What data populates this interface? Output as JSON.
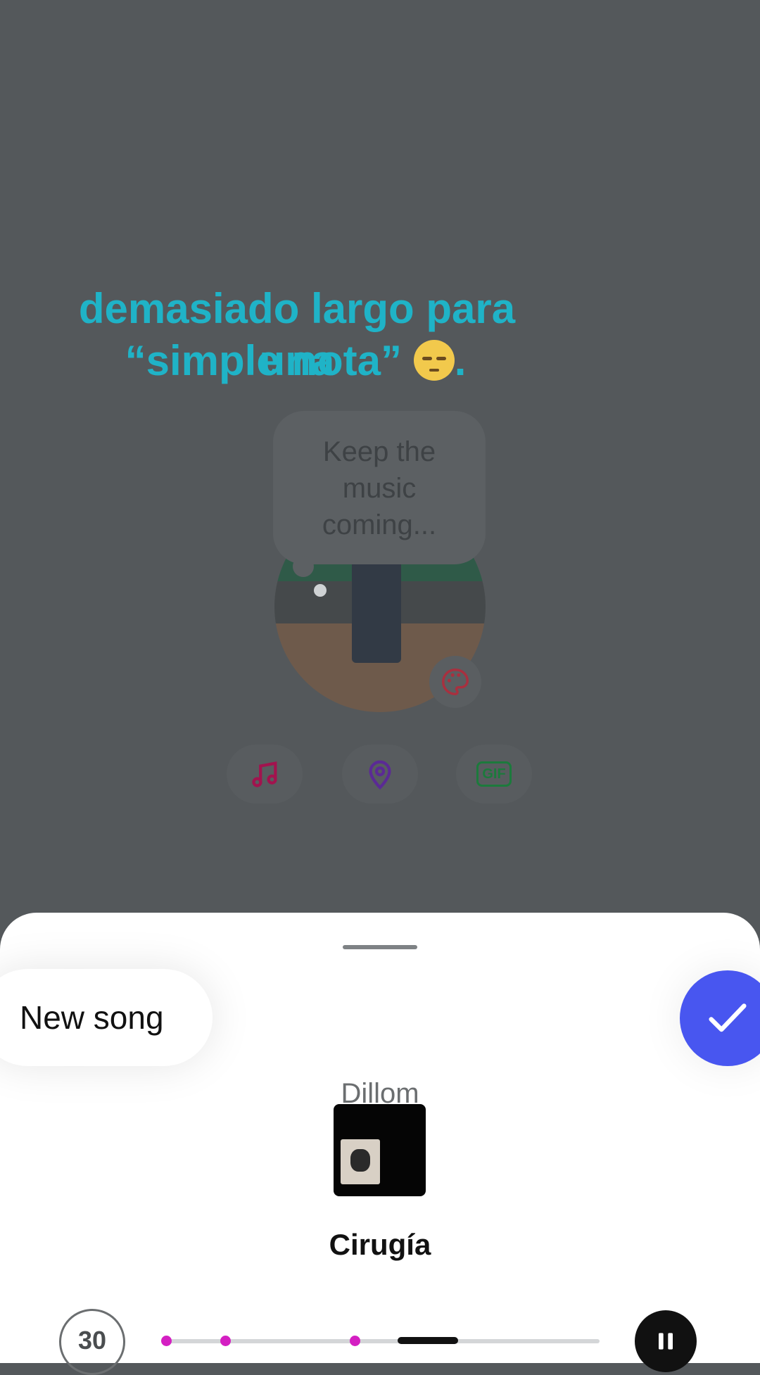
{
  "caption": {
    "line1": "demasiado largo para una",
    "line2": "“simple nota”",
    "line2_suffix": ".",
    "color": "#1fb3c7"
  },
  "note": {
    "text": "Keep the music coming..."
  },
  "actions": {
    "music_icon": "music-note-icon",
    "location_icon": "location-pin-icon",
    "gif_label": "GIF"
  },
  "sheet": {
    "new_song_label": "New song",
    "confirm_icon": "check-icon",
    "song_title": "Cirugía",
    "artist": "Dillom",
    "duration_label": "30",
    "accent": "#4856f0",
    "marker_color": "#d41fc2"
  }
}
